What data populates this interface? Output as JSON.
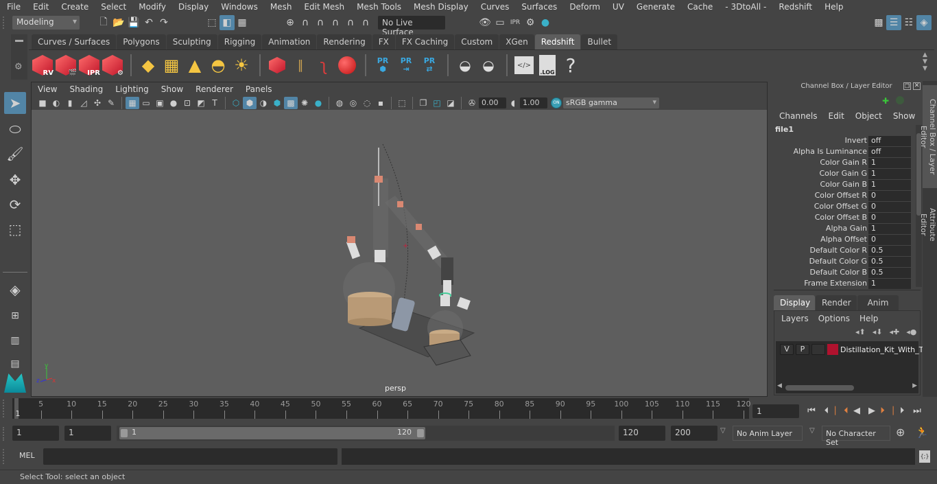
{
  "menubar": [
    "File",
    "Edit",
    "Create",
    "Select",
    "Modify",
    "Display",
    "Windows",
    "Mesh",
    "Edit Mesh",
    "Mesh Tools",
    "Mesh Display",
    "Curves",
    "Surfaces",
    "Deform",
    "UV",
    "Generate",
    "Cache",
    "- 3DtoAll -",
    "Redshift",
    "Help"
  ],
  "status_line": {
    "mode_selector": "Modeling",
    "live_surface": "No Live Surface",
    "icons": [
      "new-scene-icon",
      "open-scene-icon",
      "save-scene-icon",
      "undo-icon",
      "redo-icon",
      "select-by-hierarchy-icon",
      "select-by-object-icon",
      "select-by-component-icon",
      "snap-grid-icon",
      "snap-curve-icon",
      "snap-point-icon",
      "snap-view-plane-icon",
      "snap-live-icon",
      "make-live-icon",
      "render-view-icon",
      "render-current-icon",
      "ipr-render-icon",
      "render-settings-icon",
      "hypershade-icon"
    ],
    "right_icons": [
      "modeling-toolkit-icon",
      "attribute-editor-toggle-icon",
      "tool-settings-toggle-icon",
      "channel-box-toggle-icon"
    ]
  },
  "shelf": {
    "tabs": [
      "Curves / Surfaces",
      "Polygons",
      "Sculpting",
      "Rigging",
      "Animation",
      "Rendering",
      "FX",
      "FX Caching",
      "Custom",
      "XGen",
      "Redshift",
      "Bullet"
    ],
    "active_tab": "Redshift",
    "items": [
      {
        "name": "rs-render-view",
        "label": "RV"
      },
      {
        "name": "rs-batch-render",
        "label": ""
      },
      {
        "name": "rs-ipr",
        "label": "IPR"
      },
      {
        "name": "rs-render-settings",
        "label": ""
      },
      {
        "name": "rs-area-light",
        "label": ""
      },
      {
        "name": "rs-portal-light",
        "label": ""
      },
      {
        "name": "rs-spot-light",
        "label": ""
      },
      {
        "name": "rs-dome-light",
        "label": ""
      },
      {
        "name": "rs-sun-sky",
        "label": ""
      },
      {
        "name": "rs-volume",
        "label": ""
      },
      {
        "name": "rs-hair",
        "label": ""
      },
      {
        "name": "rs-curve",
        "label": ""
      },
      {
        "name": "rs-sphere",
        "label": ""
      },
      {
        "name": "rs-proxy-create",
        "label": "PR"
      },
      {
        "name": "rs-proxy-export",
        "label": "PR"
      },
      {
        "name": "rs-proxy-swap",
        "label": "PR"
      },
      {
        "name": "rs-baking-1",
        "label": ""
      },
      {
        "name": "rs-baking-2",
        "label": ""
      },
      {
        "name": "rs-script",
        "label": ""
      },
      {
        "name": "rs-log",
        "label": ".LOG"
      },
      {
        "name": "rs-help",
        "label": "?"
      }
    ]
  },
  "viewport": {
    "menu": [
      "View",
      "Shading",
      "Lighting",
      "Show",
      "Renderer",
      "Panels"
    ],
    "exposure": "0.00",
    "gamma": "1.00",
    "color_management_toggle": "ON",
    "view_transform": "sRGB gamma",
    "camera_label": "persp",
    "axis_labels": {
      "x": "x",
      "y": "y",
      "z": "z"
    }
  },
  "channel_box": {
    "title": "Channel Box / Layer Editor",
    "menu": [
      "Channels",
      "Edit",
      "Object",
      "Show"
    ],
    "node": "file1",
    "attributes": [
      {
        "name": "Invert",
        "value": "off"
      },
      {
        "name": "Alpha Is Luminance",
        "value": "off"
      },
      {
        "name": "Color Gain R",
        "value": "1"
      },
      {
        "name": "Color Gain G",
        "value": "1"
      },
      {
        "name": "Color Gain B",
        "value": "1"
      },
      {
        "name": "Color Offset R",
        "value": "0"
      },
      {
        "name": "Color Offset G",
        "value": "0"
      },
      {
        "name": "Color Offset B",
        "value": "0"
      },
      {
        "name": "Alpha Gain",
        "value": "1"
      },
      {
        "name": "Alpha Offset",
        "value": "0"
      },
      {
        "name": "Default Color R",
        "value": "0.5"
      },
      {
        "name": "Default Color G",
        "value": "0.5"
      },
      {
        "name": "Default Color B",
        "value": "0.5"
      },
      {
        "name": "Frame Extension",
        "value": "1"
      }
    ],
    "layer_tabs": [
      "Display",
      "Render",
      "Anim"
    ],
    "active_layer_tab": "Display",
    "layer_menu": [
      "Layers",
      "Options",
      "Help"
    ],
    "layers": [
      {
        "visible": "V",
        "playback": "P",
        "color": "#b0122e",
        "name": "Distillation_Kit_With_T"
      }
    ]
  },
  "side_tabs": [
    "Channel Box / Layer Editor",
    "Attribute Editor"
  ],
  "timeline": {
    "ticks": [
      1,
      5,
      10,
      15,
      20,
      25,
      30,
      35,
      40,
      45,
      50,
      55,
      60,
      65,
      70,
      75,
      80,
      85,
      90,
      95,
      100,
      105,
      110,
      115,
      120
    ],
    "current_frame": "1",
    "min": 1,
    "max": 120
  },
  "range": {
    "start": "1",
    "playback_start": "1",
    "slider_start": "1",
    "slider_end": "120",
    "playback_end": "120",
    "end": "200",
    "anim_layer": "No Anim Layer",
    "character_set": "No Character Set"
  },
  "command_line": {
    "language": "MEL",
    "input": "",
    "result": ""
  },
  "help_line": "Select Tool: select an object"
}
